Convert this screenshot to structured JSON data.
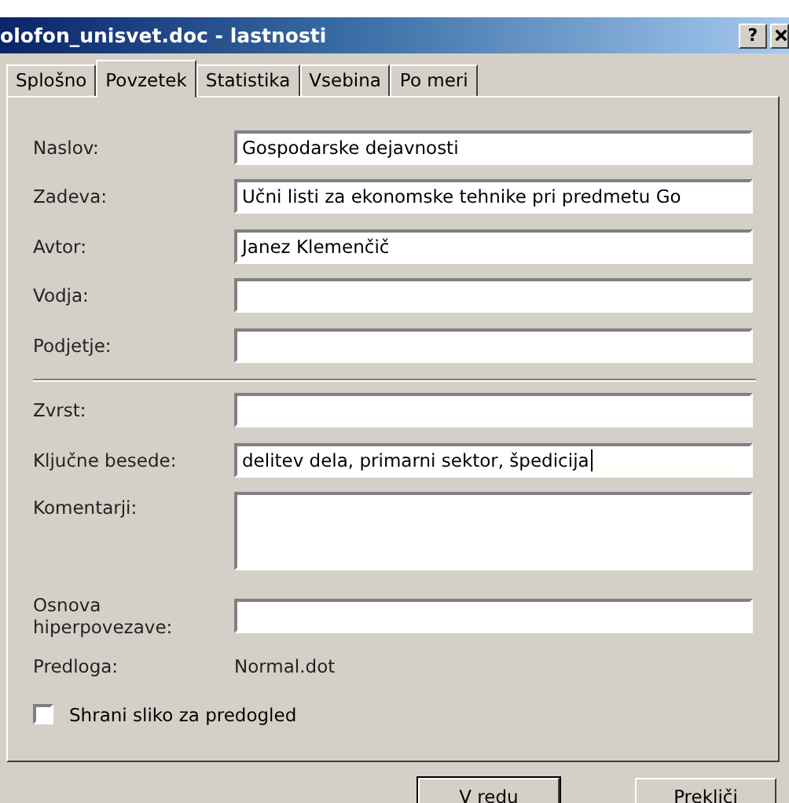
{
  "window": {
    "title": "olofon_unisvet.doc - lastnosti",
    "help": "?"
  },
  "tabs": [
    {
      "label": "Splošno",
      "selected": false
    },
    {
      "label": "Povzetek",
      "selected": true
    },
    {
      "label": "Statistika",
      "selected": false
    },
    {
      "label": "Vsebina",
      "selected": false
    },
    {
      "label": "Po meri",
      "selected": false
    }
  ],
  "field_groups": [
    [
      {
        "label": "Naslov:",
        "value": "Gospodarske dejavnosti",
        "kind": "line",
        "focused": false
      },
      {
        "label": "Zadeva:",
        "value": "Učni listi za ekonomske tehnike pri predmetu Go",
        "kind": "line",
        "focused": false
      },
      {
        "label": "Avtor:",
        "value": "Janez Klemenčič",
        "kind": "line",
        "focused": false
      },
      {
        "label": "Vodja:",
        "kind": "line",
        "focused": false
      },
      {
        "label": "Podjetje:",
        "kind": "line",
        "focused": false
      }
    ],
    [
      {
        "label": "Zvrst:",
        "kind": "line",
        "focused": false
      },
      {
        "label": "Ključne besede:",
        "value": "delitev dela, primarni sektor, špedicija",
        "kind": "line",
        "focused": true
      },
      {
        "label": "Komentarji:",
        "kind": "multiline",
        "focused": false
      },
      {
        "label": "Osnova hiperpovezave:",
        "kind": "line",
        "focused": false
      },
      {
        "label": "Predloga:",
        "value": "Normal.dot",
        "kind": "static"
      }
    ]
  ],
  "checkbox": {
    "label": "Shrani sliko za predogled",
    "checked": false
  },
  "buttons": [
    "V redu",
    "Prekliči"
  ]
}
